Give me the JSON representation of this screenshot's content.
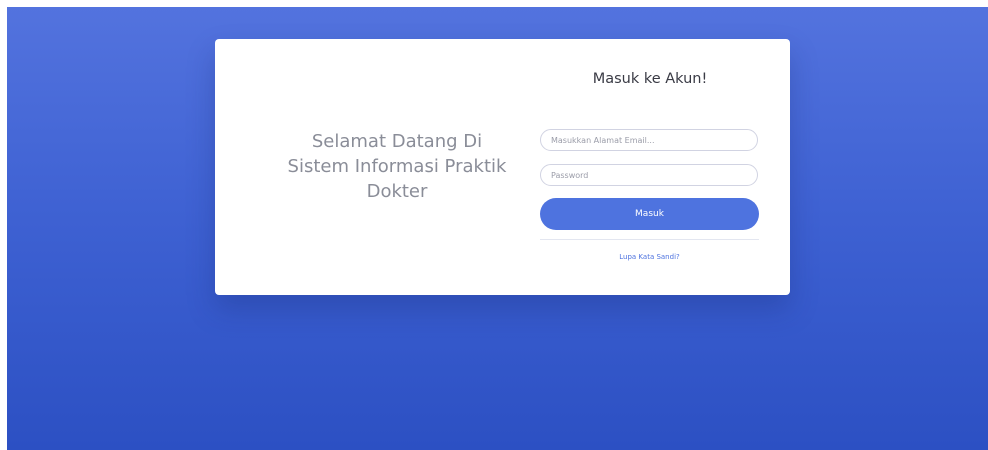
{
  "welcome": {
    "line1": "Selamat Datang Di",
    "line2": "Sistem Informasi Praktik",
    "line3": "Dokter"
  },
  "login": {
    "title": "Masuk ke Akun!",
    "email_placeholder": "Masukkan Alamat Email...",
    "password_placeholder": "Password",
    "submit_label": "Masuk",
    "forgot_link": "Lupa Kata Sandi?"
  },
  "colors": {
    "background_top": "#5373de",
    "background_bottom": "#2c50c3",
    "primary": "#4e73df",
    "card": "#ffffff"
  }
}
